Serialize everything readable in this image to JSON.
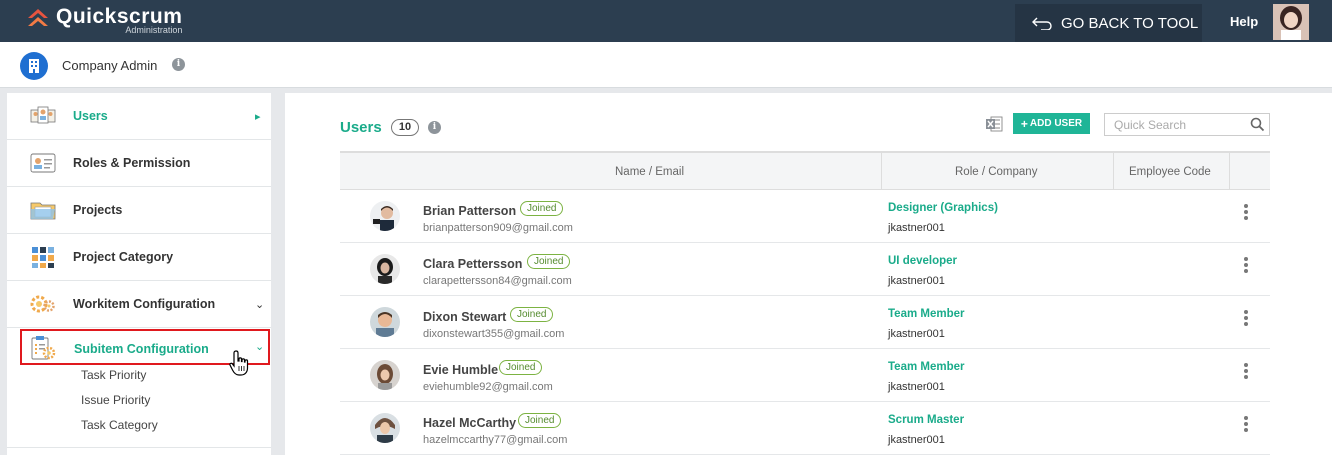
{
  "app": {
    "name": "Quickscrum",
    "subtitle": "Administration",
    "go_back_label": "GO BACK TO TOOL",
    "help_label": "Help"
  },
  "admin_bar": {
    "title": "Company Admin",
    "info_glyph": "i"
  },
  "sidebar": {
    "items": [
      {
        "label": "Users",
        "icon": "users-icon",
        "arrow": "▸"
      },
      {
        "label": "Roles & Permission",
        "icon": "id-card-icon"
      },
      {
        "label": "Projects",
        "icon": "folder-icon"
      },
      {
        "label": "Project Category",
        "icon": "grid-icon"
      },
      {
        "label": "Workitem Configuration",
        "icon": "gears-icon",
        "arrow": "⌄"
      },
      {
        "label": "Subitem Configuration",
        "icon": "clipboard-gear-icon",
        "arrow": "⌄"
      }
    ],
    "sub_items": [
      "Task Priority",
      "Issue Priority",
      "Task Category"
    ]
  },
  "users_panel": {
    "title": "Users",
    "count": "10",
    "add_user_label": "ADD USER",
    "add_user_plus": "+",
    "search_placeholder": "Quick Search",
    "columns": [
      "Name / Email",
      "Role / Company",
      "Employee Code"
    ],
    "badge_label": "Joined",
    "rows": [
      {
        "name": "Brian Patterson",
        "email": "brianpatterson909@gmail.com",
        "role": "Designer (Graphics)",
        "company": "jkastner001"
      },
      {
        "name": "Clara Pettersson",
        "email": "clarapettersson84@gmail.com",
        "role": "UI developer",
        "company": "jkastner001"
      },
      {
        "name": "Dixon Stewart",
        "email": "dixonstewart355@gmail.com",
        "role": "Team Member",
        "company": "jkastner001"
      },
      {
        "name": "Evie Humble",
        "email": "eviehumble92@gmail.com",
        "role": "Team Member",
        "company": "jkastner001"
      },
      {
        "name": "Hazel McCarthy",
        "email": "hazelmccarthy77@gmail.com",
        "role": "Scrum Master",
        "company": "jkastner001"
      }
    ]
  },
  "colors": {
    "topbar": "#2c3e50",
    "accent": "#1aab8a",
    "highlight": "#e0191e",
    "admin_icon": "#1f6fd1"
  }
}
